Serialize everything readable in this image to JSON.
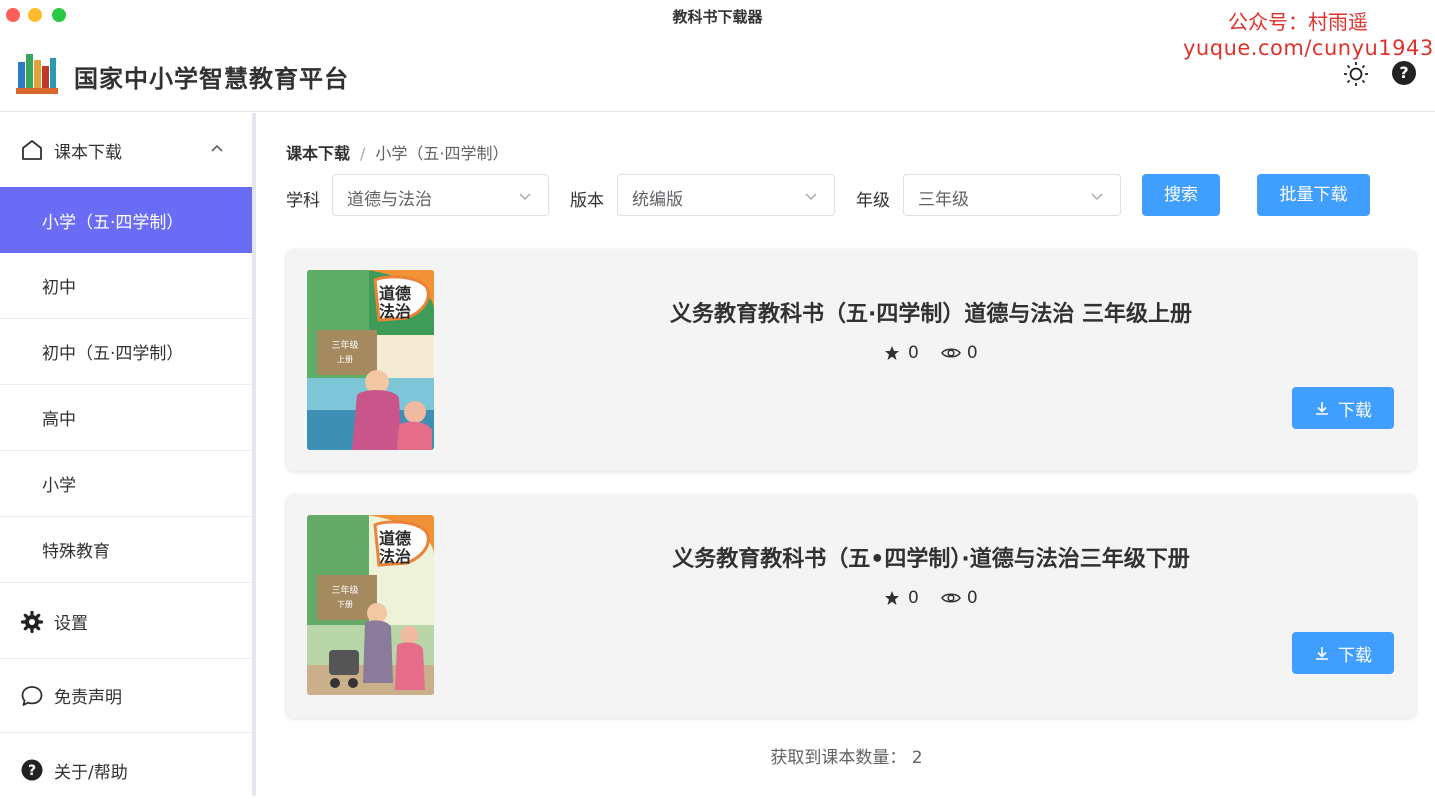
{
  "window": {
    "title": "教科书下载器"
  },
  "watermark": {
    "line1": "公众号：村雨遥",
    "line2": "yuque.com/cunyu1943"
  },
  "header": {
    "app_name": "国家中小学智慧教育平台"
  },
  "sidebar": {
    "section": {
      "label": "课本下载",
      "icon": "home-icon"
    },
    "items": [
      {
        "label": "小学（五·四学制）",
        "active": true
      },
      {
        "label": "初中"
      },
      {
        "label": "初中（五·四学制）"
      },
      {
        "label": "高中"
      },
      {
        "label": "小学"
      },
      {
        "label": "特殊教育"
      }
    ],
    "settings": {
      "label": "设置",
      "icon": "gear-icon"
    },
    "disclaimer": {
      "label": "免责声明",
      "icon": "chat-bubble-icon"
    },
    "about": {
      "label": "关于/帮助",
      "icon": "question-icon"
    }
  },
  "breadcrumb": {
    "root": "课本下载",
    "current": "小学（五·四学制）"
  },
  "filters": {
    "subject_label": "学科",
    "subject_value": "道德与法治",
    "edition_label": "版本",
    "edition_value": "统编版",
    "grade_label": "年级",
    "grade_value": "三年级",
    "search_label": "搜索",
    "batch_label": "批量下载"
  },
  "books": [
    {
      "title": "义务教育教科书（五·四学制）道德与法治 三年级上册",
      "stars": "0",
      "views": "0",
      "download_label": "下载",
      "cover_title": "道德与法治",
      "cover_grade": "三年级",
      "cover_term": "上册"
    },
    {
      "title": "义务教育教科书（五•四学制）·道德与法治三年级下册",
      "stars": "0",
      "views": "0",
      "download_label": "下载",
      "cover_title": "道德与法治",
      "cover_grade": "三年级",
      "cover_term": "下册"
    }
  ],
  "footer": {
    "count_text": "获取到课本数量： 2"
  },
  "colors": {
    "primary": "#409eff",
    "active_menu": "#6b6cf6",
    "watermark": "#e0322c"
  }
}
